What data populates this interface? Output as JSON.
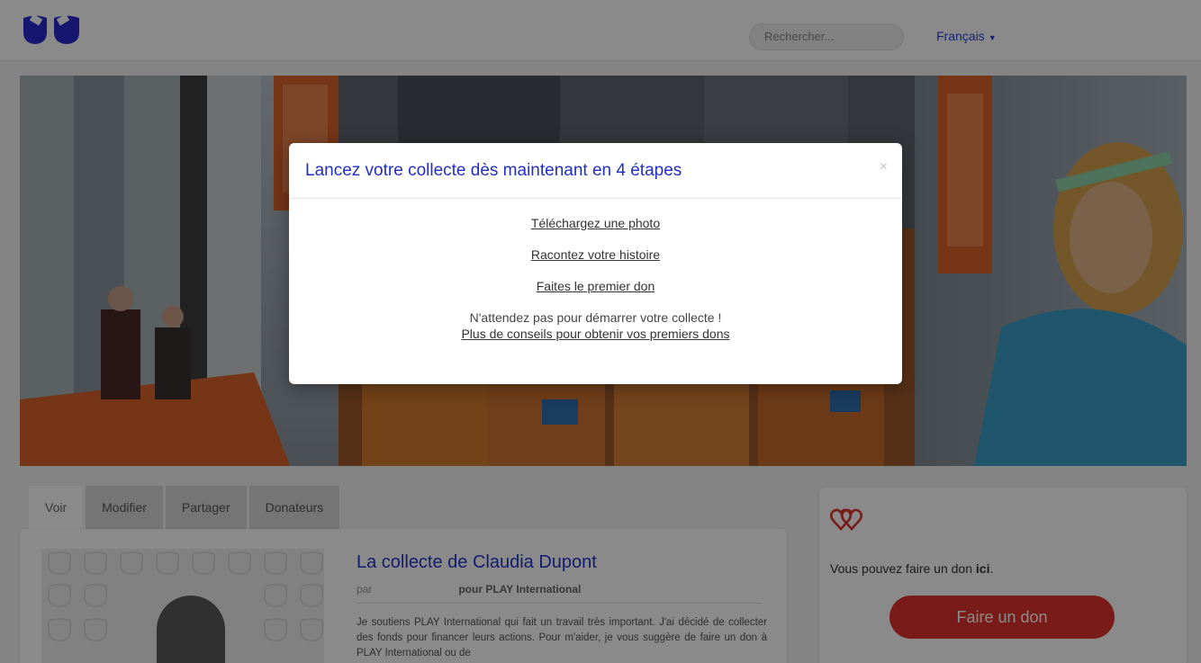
{
  "header": {
    "search_placeholder": "Rechercher...",
    "language": "Français"
  },
  "tabs": [
    {
      "label": "Voir"
    },
    {
      "label": "Modifier"
    },
    {
      "label": "Partager"
    },
    {
      "label": "Donateurs"
    }
  ],
  "campaign": {
    "title_prefix": "La collecte de",
    "owner": "Claudia Dupont",
    "by": "par",
    "for": "pour PLAY International",
    "text": "Je soutiens PLAY International qui fait un travail très important. J'ai décidé de collecter des fonds pour financer leurs actions. Pour m'aider, je vous suggère de faire un don à PLAY International ou de"
  },
  "donate": {
    "text_prefix": "Vous pouvez faire un don",
    "text_bold": "ici",
    "button": "Faire un don",
    "accent": "#e0342f"
  },
  "modal": {
    "title": "Lancez votre collecte dès maintenant en 4 étapes",
    "close": "×",
    "steps": [
      "Téléchargez une photo",
      "Racontez votre histoire",
      "Faites le premier don"
    ],
    "note": "N'attendez pas pour démarrer votre collecte !",
    "tips_link": "Plus de conseils pour obtenir vos premiers dons"
  },
  "colors": {
    "brand_blue": "#2130c4",
    "overlay": "rgba(0,0,0,0.46)"
  }
}
